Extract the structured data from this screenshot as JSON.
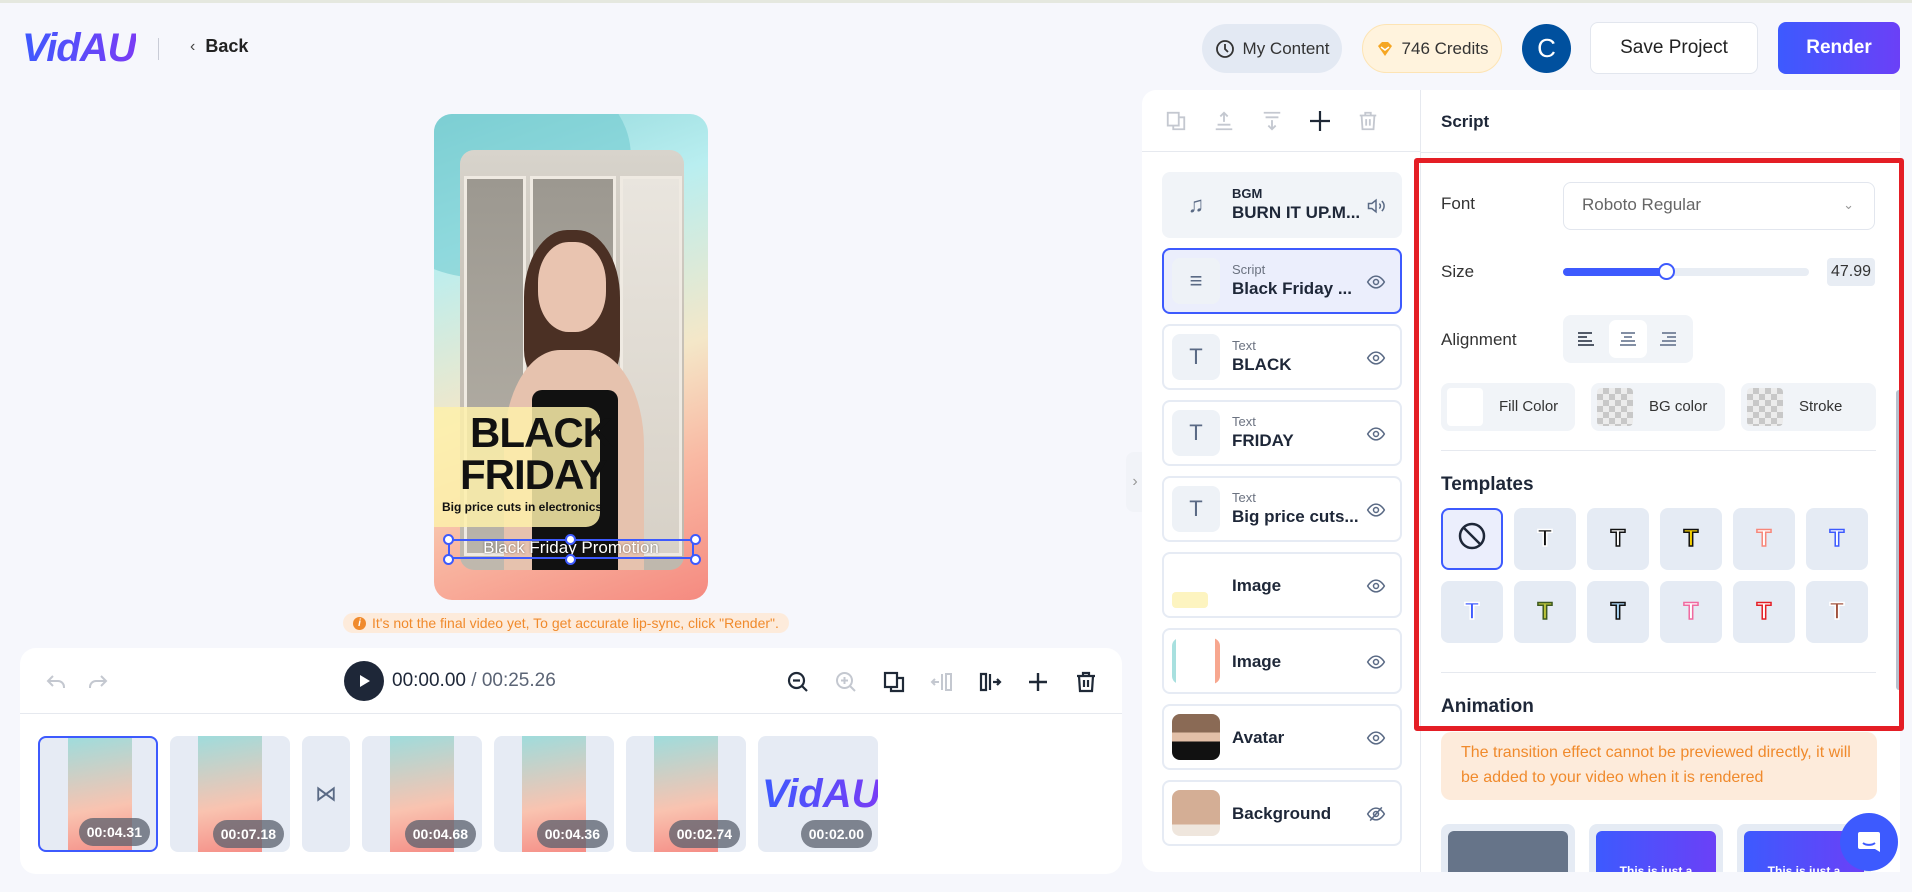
{
  "header": {
    "logo": "VidAU",
    "back_label": "Back",
    "my_content_label": "My Content",
    "credits_label": "746 Credits",
    "avatar_initial": "C",
    "save_label": "Save Project",
    "render_label": "Render"
  },
  "preview": {
    "overlay_title_line1": "BLACK",
    "overlay_title_line2": "FRIDAY",
    "overlay_subtitle": "Big price cuts in electronics",
    "script_text": "Black Friday Promotion",
    "notice": "It's not the final video yet, To get accurate lip-sync, click \"Render\"."
  },
  "timeline": {
    "current_time": "00:00.00",
    "separator": " / ",
    "total_time": "00:25.26",
    "clips": [
      {
        "duration": "00:04.31",
        "selected": true
      },
      {
        "duration": "00:07.18",
        "selected": false
      },
      {
        "transition": true
      },
      {
        "duration": "00:04.68",
        "selected": false
      },
      {
        "duration": "00:04.36",
        "selected": false
      },
      {
        "duration": "00:02.74",
        "selected": false
      },
      {
        "duration": "00:02.00",
        "selected": false,
        "logo": "VidAU"
      }
    ]
  },
  "layers": {
    "items": [
      {
        "type": "BGM",
        "name": "BURN IT UP.M..."
      },
      {
        "type": "Script",
        "name": "Black Friday ..."
      },
      {
        "type": "Text",
        "name": "BLACK"
      },
      {
        "type": "Text",
        "name": "FRIDAY"
      },
      {
        "type": "Text",
        "name": "Big price cuts..."
      },
      {
        "type": "",
        "name": "Image"
      },
      {
        "type": "",
        "name": "Image"
      },
      {
        "type": "",
        "name": "Avatar"
      },
      {
        "type": "",
        "name": "Background"
      }
    ]
  },
  "props": {
    "title": "Script",
    "font_label": "Font",
    "font_value": "Roboto Regular",
    "size_label": "Size",
    "size_value": "47.99",
    "size_slider_fraction": 0.42,
    "alignment_label": "Alignment",
    "alignment_selected": "center",
    "fill_color_label": "Fill Color",
    "fill_color": "#ffffff",
    "bg_color_label": "BG color",
    "stroke_label": "Stroke",
    "templates_label": "Templates",
    "templates": [
      {
        "glyph": "⃠",
        "name": "none"
      },
      {
        "glyph": "T",
        "color": "#111111",
        "stroke": "#ffffff"
      },
      {
        "glyph": "T",
        "color": "#ffffff",
        "stroke": "#111111"
      },
      {
        "glyph": "T",
        "color": "#f5d000",
        "stroke": "#111111"
      },
      {
        "glyph": "T",
        "color": "#ffffff",
        "stroke": "#f7877a"
      },
      {
        "glyph": "T",
        "color": "#ffffff",
        "stroke": "#3d5afe"
      },
      {
        "glyph": "T",
        "color": "#3d5afe",
        "stroke": "#ffffff"
      },
      {
        "glyph": "T",
        "color": "#b9c23a",
        "stroke": "#3e5a20"
      },
      {
        "glyph": "T",
        "color": "#a9d5f5",
        "stroke": "#111111"
      },
      {
        "glyph": "T",
        "color": "#ffffff",
        "stroke": "#f06aa0"
      },
      {
        "glyph": "T",
        "color": "#ffffff",
        "stroke": "#e41e25"
      },
      {
        "glyph": "T",
        "color": "#a0523d",
        "stroke": "#ffffff"
      }
    ],
    "animation_label": "Animation",
    "transition_note": "The transition effect cannot be previewed directly, it will be added to your video when it is rendered",
    "animation_previews": [
      {
        "text": ""
      },
      {
        "text": "This is just a"
      },
      {
        "text": "This is just a"
      }
    ]
  },
  "colors": {
    "accent": "#3d5afe",
    "highlight_box": "#e41e25",
    "warning": "#f08a2c"
  }
}
